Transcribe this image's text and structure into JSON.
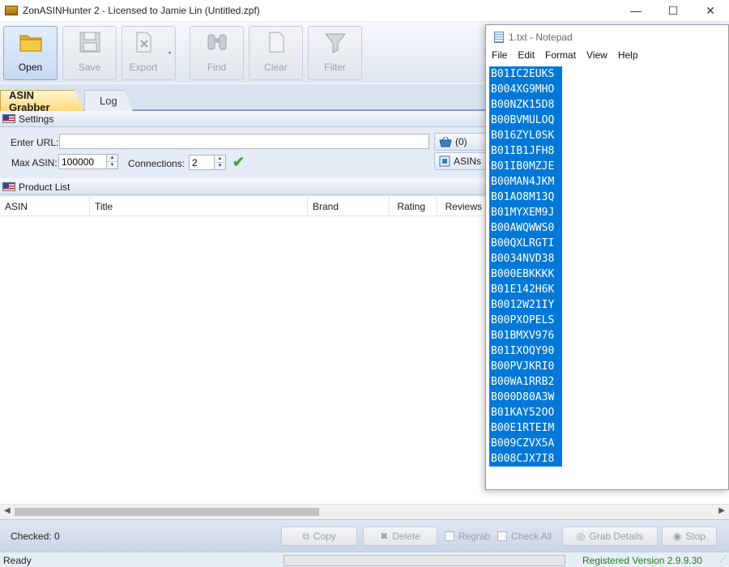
{
  "window": {
    "title": "ZonASINHunter 2 - Licensed to Jamie Lin (Untitled.zpf)",
    "controls": {
      "minimize": "—",
      "maximize": "☐",
      "close": "✕"
    }
  },
  "toolbar": {
    "open": "Open",
    "save": "Save",
    "export": "Export",
    "export_dropdown": "▾",
    "find": "Find",
    "clear": "Clear",
    "filter": "Filter"
  },
  "tabs": [
    {
      "label": "ASIN Grabber",
      "active": true
    },
    {
      "label": "Log",
      "active": false
    }
  ],
  "settings": {
    "header": "Settings",
    "url_label": "Enter URL:",
    "url_value": "",
    "max_asin_label": "Max ASIN:",
    "max_asin_value": "100000",
    "connections_label": "Connections:",
    "connections_value": "2",
    "basket_button": "(0)",
    "asins_button": "ASINs"
  },
  "product_list": {
    "header": "Product List",
    "columns": [
      "ASIN",
      "Title",
      "Brand",
      "Rating",
      "Reviews"
    ],
    "rows": []
  },
  "bottom": {
    "checked": "Checked: 0",
    "copy": "Copy",
    "delete": "Delete",
    "regrab": "Regrab",
    "check_all": "Check All",
    "grab_details": "Grab Details",
    "stop": "Stop"
  },
  "status": {
    "state": "Ready",
    "progress": 0,
    "version": "Registered Version 2.9.9.30"
  },
  "notepad": {
    "title": "1.txt - Notepad",
    "menu": [
      "File",
      "Edit",
      "Format",
      "View",
      "Help"
    ],
    "lines": [
      "B01IC2EUKS",
      "B004XG9MHO",
      "B00NZK15D8",
      "B00BVMULOQ",
      "B016ZYL0SK",
      "B01IB1JFH8",
      "B01IB0MZJE",
      "B00MAN4JKM",
      "B01AO8M13Q",
      "B01MYXEM9J",
      "B00AWQWWS0",
      "B00QXLRGTI",
      "B0034NVD38",
      "B000EBKKKK",
      "B01E142H6K",
      "B0012W21IY",
      "B00PXOPELS",
      "B01BMXV976",
      "B01IXOQY90",
      "B00PVJKRI0",
      "B00WA1RRB2",
      "B000D80A3W",
      "B01KAY52OO",
      "B00E1RTEIM",
      "B009CZVX5A",
      "B008CJX7I8"
    ]
  },
  "colors": {
    "selection": "#0078d7",
    "progress": "#06b025",
    "version_text": "#1e7b1e",
    "active_tab": "#ffd97a"
  }
}
